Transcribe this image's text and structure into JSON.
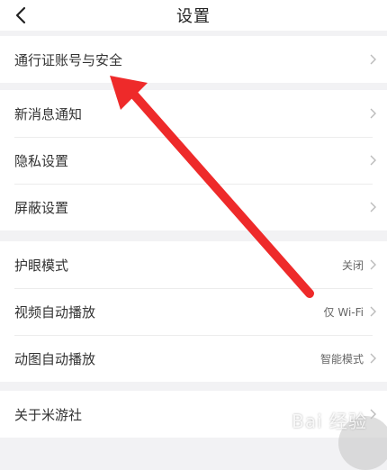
{
  "header": {
    "title": "设置",
    "back_icon": "chevron-left-icon"
  },
  "groups": [
    {
      "items": [
        {
          "label": "通行证账号与安全",
          "value": ""
        }
      ]
    },
    {
      "items": [
        {
          "label": "新消息通知",
          "value": ""
        },
        {
          "label": "隐私设置",
          "value": ""
        },
        {
          "label": "屏蔽设置",
          "value": ""
        }
      ]
    },
    {
      "items": [
        {
          "label": "护眼模式",
          "value": "关闭"
        },
        {
          "label": "视频自动播放",
          "value": "仅 Wi-Fi"
        },
        {
          "label": "动图自动播放",
          "value": "智能模式"
        }
      ]
    },
    {
      "items": [
        {
          "label": "关于米游社",
          "value": ""
        }
      ]
    }
  ],
  "annotation": {
    "arrow_color": "#ee2a2a"
  },
  "watermark": {
    "text": "Bai 经验"
  }
}
